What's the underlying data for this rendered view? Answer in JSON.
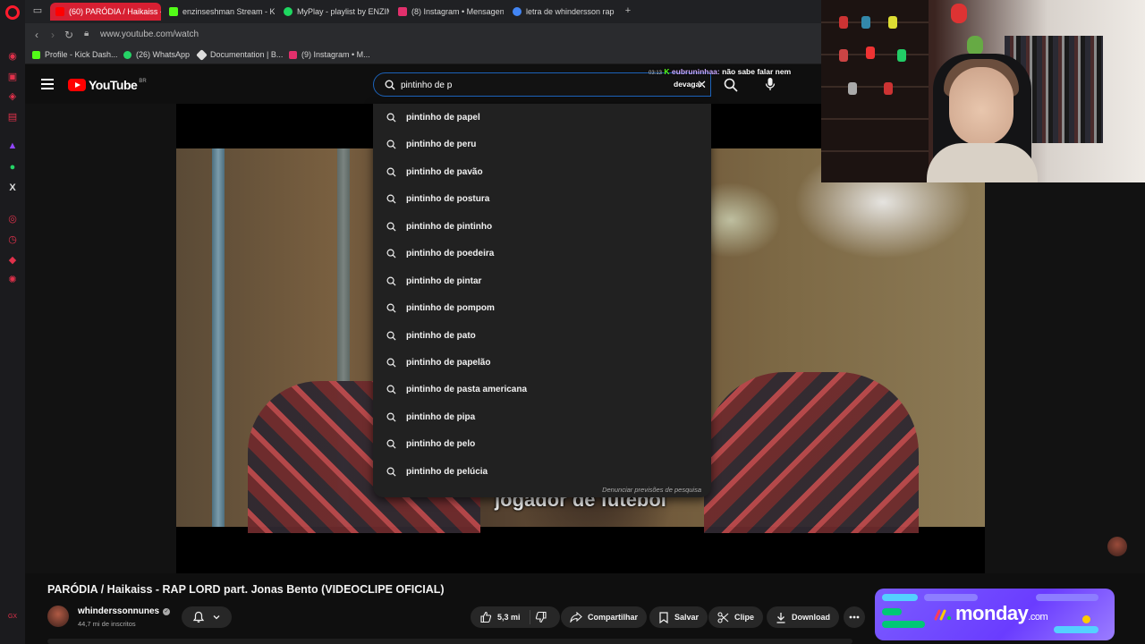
{
  "browser": {
    "tabs": [
      {
        "label": "(60) PARÓDIA / Haikaiss -",
        "active": true,
        "favicon_color": "#ff0000"
      },
      {
        "label": "enzinseshman Stream - K",
        "active": false,
        "favicon_color": "#53fc18"
      },
      {
        "label": "MyPlay - playlist by ENZIM",
        "active": false,
        "favicon_color": "#1ed760"
      },
      {
        "label": "(8) Instagram • Mensagen",
        "active": false,
        "favicon_color": "#e1306c"
      },
      {
        "label": "letra de whindersson rap",
        "active": false,
        "favicon_color": "#4285f4"
      }
    ],
    "new_tab": "+",
    "url": "www.youtube.com/watch",
    "bookmarks": [
      {
        "label": "Profile - Kick Dash...",
        "favicon_color": "#53fc18"
      },
      {
        "label": "(26) WhatsApp",
        "favicon_color": "#25d366"
      },
      {
        "label": "Documentation | B...",
        "favicon_color": "#dddddd"
      },
      {
        "label": "(9) Instagram • M...",
        "favicon_color": "#e1306c"
      }
    ]
  },
  "youtube": {
    "logo_text": "YouTube",
    "region": "BR",
    "search_value": "pintinho de p",
    "suggestions": [
      "pintinho de papel",
      "pintinho de peru",
      "pintinho de pavão",
      "pintinho de postura",
      "pintinho de pintinho",
      "pintinho de poedeira",
      "pintinho de pintar",
      "pintinho de pompom",
      "pintinho de pato",
      "pintinho de papelão",
      "pintinho de pasta americana",
      "pintinho de pipa",
      "pintinho de pelo",
      "pintinho de pelúcia"
    ],
    "report_text": "Denunciar previsões de pesquisa",
    "subtitle_caption": "jogador de futebol",
    "video": {
      "title": "PARÓDIA / Haikaiss - RAP LORD part. Jonas Bento (VIDEOCLIPE OFICIAL)",
      "channel": "whinderssonnunes",
      "subscribers": "44,7 mi de inscritos",
      "likes": "5,3 mi",
      "share": "Compartilhar",
      "save": "Salvar",
      "clip": "Clipe",
      "download": "Download"
    },
    "ad_brand": "monday",
    "ad_suffix": ".com"
  },
  "stream_chat": {
    "time": "03:13",
    "user": "eubruninhaa:",
    "message": "não sabe falar nem",
    "message_cont": "devagar"
  },
  "colors": {
    "youtube_red": "#ff0000",
    "opera_red": "#d71f32",
    "search_focus": "#1c62b9",
    "monday_purple": "#6a3cff"
  }
}
